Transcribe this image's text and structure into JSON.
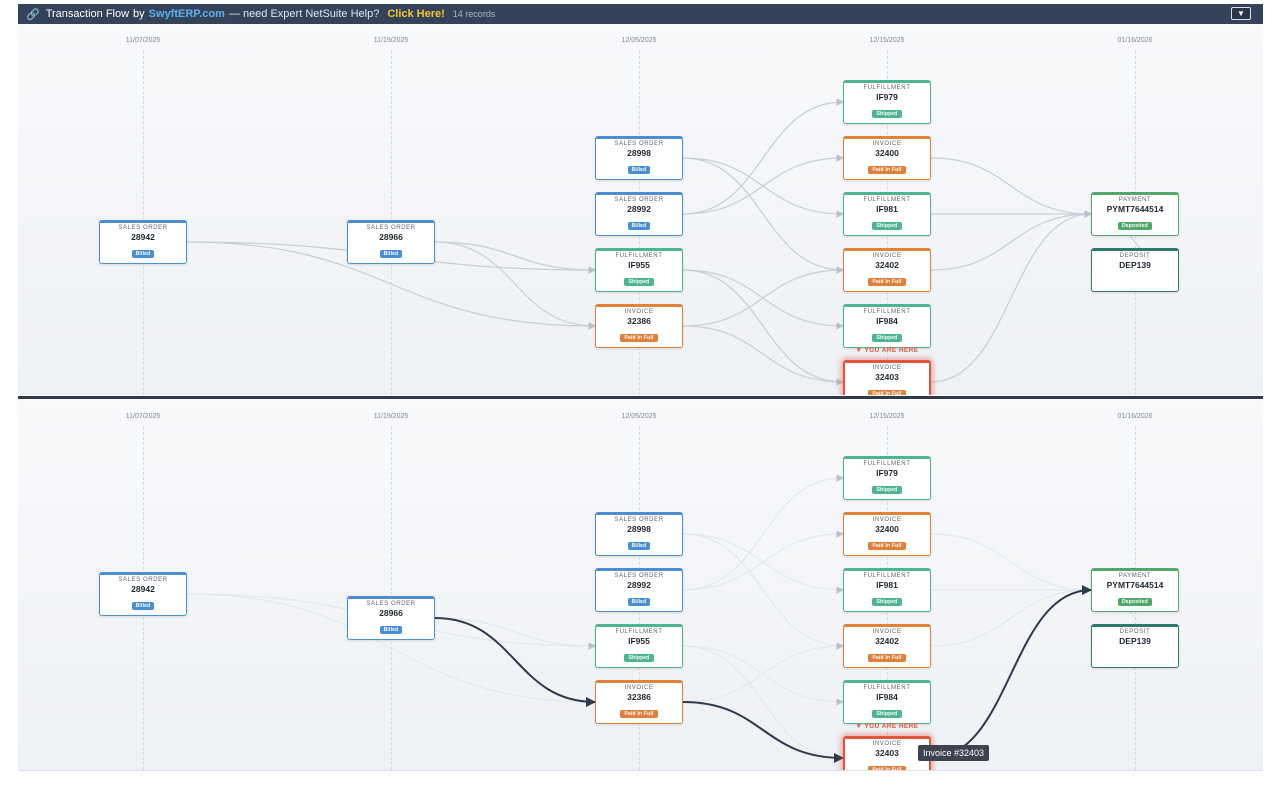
{
  "header": {
    "icon": "link-icon",
    "title": "Transaction Flow",
    "by": "by",
    "brand": "SwyftERP.com",
    "tagline": "— need Expert NetSuite Help?",
    "cta": "Click Here!",
    "count": "14 records",
    "toggle_icon": "▼"
  },
  "dates": [
    "11/07/2025",
    "11/19/2025",
    "12/05/2025",
    "12/15/2025",
    "01/16/2026"
  ],
  "you_are_here": "▼ YOU ARE HERE",
  "tooltip": "Invoice #32403",
  "colors": {
    "header_bg": "#34435a",
    "sales_order": "#4a8fd4",
    "fulfillment": "#4fb591",
    "invoice": "#e0813c",
    "payment": "#52a86a",
    "deposit": "#2f7a6b",
    "current": "#e0563c",
    "highlight_path": "#2e3a4c"
  },
  "panel_a": {
    "nodes": [
      {
        "id": "so28942",
        "kind": "so",
        "type": "SALES ORDER",
        "number": "28942",
        "status": "Billed"
      },
      {
        "id": "so28966",
        "kind": "so",
        "type": "SALES ORDER",
        "number": "28966",
        "status": "Billed"
      },
      {
        "id": "so28998",
        "kind": "so",
        "type": "SALES ORDER",
        "number": "28998",
        "status": "Billed"
      },
      {
        "id": "so28992",
        "kind": "so",
        "type": "SALES ORDER",
        "number": "28992",
        "status": "Billed"
      },
      {
        "id": "ifIF955",
        "kind": "ff",
        "type": "FULFILLMENT",
        "number": "IF955",
        "status": "Shipped"
      },
      {
        "id": "inv32386",
        "kind": "inv",
        "type": "INVOICE",
        "number": "32386",
        "status": "Paid In Full"
      },
      {
        "id": "ifIF979",
        "kind": "ff",
        "type": "FULFILLMENT",
        "number": "IF979",
        "status": "Shipped"
      },
      {
        "id": "inv32400",
        "kind": "inv",
        "type": "INVOICE",
        "number": "32400",
        "status": "Paid In Full"
      },
      {
        "id": "ifIF981",
        "kind": "ff",
        "type": "FULFILLMENT",
        "number": "IF981",
        "status": "Shipped"
      },
      {
        "id": "inv32402",
        "kind": "inv",
        "type": "INVOICE",
        "number": "32402",
        "status": "Paid In Full"
      },
      {
        "id": "ifIF984",
        "kind": "ff",
        "type": "FULFILLMENT",
        "number": "IF984",
        "status": "Shipped"
      },
      {
        "id": "inv32403",
        "kind": "inv",
        "type": "INVOICE",
        "number": "32403",
        "status": "Paid In Full",
        "current": true
      },
      {
        "id": "payPYMT7644514",
        "kind": "pay",
        "type": "PAYMENT",
        "number": "PYMT7644514",
        "status": "Deposited"
      },
      {
        "id": "depDEP139",
        "kind": "dep",
        "type": "DEPOSIT",
        "number": "DEP139",
        "status": ""
      }
    ]
  },
  "panel_b": {
    "nodes": [
      {
        "id": "so28942",
        "kind": "so",
        "type": "SALES ORDER",
        "number": "28942",
        "status": "Billed"
      },
      {
        "id": "so28966",
        "kind": "so",
        "type": "SALES ORDER",
        "number": "28966",
        "status": "Billed"
      },
      {
        "id": "so28998",
        "kind": "so",
        "type": "SALES ORDER",
        "number": "28998",
        "status": "Billed"
      },
      {
        "id": "so28992",
        "kind": "so",
        "type": "SALES ORDER",
        "number": "28992",
        "status": "Billed"
      },
      {
        "id": "ifIF955",
        "kind": "ff",
        "type": "FULFILLMENT",
        "number": "IF955",
        "status": "Shipped"
      },
      {
        "id": "inv32386",
        "kind": "inv",
        "type": "INVOICE",
        "number": "32386",
        "status": "Paid In Full"
      },
      {
        "id": "ifIF979",
        "kind": "ff",
        "type": "FULFILLMENT",
        "number": "IF979",
        "status": "Shipped"
      },
      {
        "id": "inv32400",
        "kind": "inv",
        "type": "INVOICE",
        "number": "32400",
        "status": "Paid In Full"
      },
      {
        "id": "ifIF981",
        "kind": "ff",
        "type": "FULFILLMENT",
        "number": "IF981",
        "status": "Shipped"
      },
      {
        "id": "inv32402",
        "kind": "inv",
        "type": "INVOICE",
        "number": "32402",
        "status": "Paid In Full"
      },
      {
        "id": "ifIF984",
        "kind": "ff",
        "type": "FULFILLMENT",
        "number": "IF984",
        "status": "Shipped"
      },
      {
        "id": "inv32403",
        "kind": "inv",
        "type": "INVOICE",
        "number": "32403",
        "status": "Paid In Full",
        "current": true
      },
      {
        "id": "payPYMT7644514",
        "kind": "pay",
        "type": "PAYMENT",
        "number": "PYMT7644514",
        "status": "Deposited"
      },
      {
        "id": "depDEP139",
        "kind": "dep",
        "type": "DEPOSIT",
        "number": "DEP139",
        "status": ""
      }
    ]
  }
}
